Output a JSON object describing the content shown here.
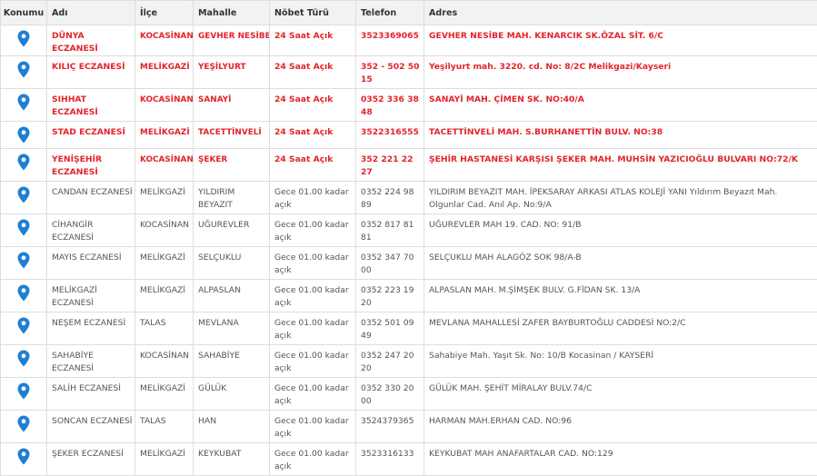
{
  "colors": {
    "duty": "#e3242b",
    "normal": "#555555",
    "pin": "#1f7fd2",
    "grid": "#dddddd",
    "header_bg": "#f2f2f2"
  },
  "header": {
    "konumu": "Konumu",
    "adi": "Adı",
    "ilce": "İlçe",
    "mahalle": "Mahalle",
    "nobet": "Nöbet Türü",
    "telefon": "Telefon",
    "adres": "Adres"
  },
  "rows": [
    {
      "duty": true,
      "name": "DÜNYA ECZANESİ",
      "ilce": "KOCASİNAN",
      "mahalle": "GEVHER NESİBE",
      "nobet": "24 Saat Açık",
      "telefon": "3523369065",
      "adres": "GEVHER NESİBE MAH. KENARCIK SK.ÖZAL SİT. 6/C",
      "icon": "map-pin-icon"
    },
    {
      "duty": true,
      "name": "KILIÇ ECZANESİ",
      "ilce": "MELİKGAZİ",
      "mahalle": "YEŞİLYURT",
      "nobet": "24 Saat Açık",
      "telefon": "352 - 502 50 15",
      "adres": "Yeşilyurt mah. 3220. cd. No: 8/2C Melikgazi/Kayseri",
      "icon": "map-pin-icon"
    },
    {
      "duty": true,
      "name": "SIHHAT ECZANESİ",
      "ilce": "KOCASİNAN",
      "mahalle": "SANAYİ",
      "nobet": "24 Saat Açık",
      "telefon": "0352 336 38 48",
      "adres": "SANAYİ MAH. ÇİMEN SK. NO:40/A",
      "icon": "map-pin-icon"
    },
    {
      "duty": true,
      "name": "STAD ECZANESİ",
      "ilce": "MELİKGAZİ",
      "mahalle": "TACETTİNVELİ",
      "nobet": "24 Saat Açık",
      "telefon": "3522316555",
      "adres": "TACETTİNVELİ MAH. S.BURHANETTİN BULV. NO:38",
      "icon": "map-pin-icon"
    },
    {
      "duty": true,
      "name": "YENİŞEHİR ECZANESİ",
      "ilce": "KOCASİNAN",
      "mahalle": "ŞEKER",
      "nobet": "24 Saat Açık",
      "telefon": "352 221 22 27",
      "adres": "ŞEHİR HASTANESİ KARŞISI ŞEKER MAH. MUHSİN YAZICIOĞLU BULVARI NO:72/K",
      "icon": "map-pin-icon"
    },
    {
      "duty": false,
      "name": "CANDAN ECZANESİ",
      "ilce": "MELİKGAZİ",
      "mahalle": "YILDIRIM BEYAZIT",
      "nobet": "Gece 01.00 kadar açık",
      "telefon": "0352 224 98 89",
      "adres": "YILDIRIM BEYAZIT MAH. İPEKSARAY ARKASI ATLAS KOLEJİ YANI Yıldırım Beyazıt Mah. Olgunlar Cad. Anıl Ap. No:9/A",
      "icon": "map-pin-icon"
    },
    {
      "duty": false,
      "name": "CİHANGİR ECZANESİ",
      "ilce": "KOCASİNAN",
      "mahalle": "UĞUREVLER",
      "nobet": "Gece 01.00 kadar açık",
      "telefon": "0352 817 81 81",
      "adres": "UĞUREVLER MAH 19. CAD. NO: 91/B",
      "icon": "map-pin-icon"
    },
    {
      "duty": false,
      "name": "MAYIS ECZANESİ",
      "ilce": "MELİKGAZİ",
      "mahalle": "SELÇUKLU",
      "nobet": "Gece 01.00 kadar açık",
      "telefon": "0352 347 70 00",
      "adres": "SELÇUKLU MAH ALAGÖZ SOK 98/A-B",
      "icon": "map-pin-icon"
    },
    {
      "duty": false,
      "name": "MELİKGAZİ ECZANESİ",
      "ilce": "MELİKGAZİ",
      "mahalle": "ALPASLAN",
      "nobet": "Gece 01.00 kadar açık",
      "telefon": "0352 223 19 20",
      "adres": "ALPASLAN MAH. M.ŞİMŞEK BULV. G.FİDAN SK. 13/A",
      "icon": "map-pin-icon"
    },
    {
      "duty": false,
      "name": "NEŞEM ECZANESİ",
      "ilce": "TALAS",
      "mahalle": "MEVLANA",
      "nobet": "Gece 01.00 kadar açık",
      "telefon": "0352 501 09 49",
      "adres": "MEVLANA MAHALLESİ ZAFER BAYBURTOĞLU CADDESİ NO:2/C",
      "icon": "map-pin-icon"
    },
    {
      "duty": false,
      "name": "SAHABİYE ECZANESİ",
      "ilce": "KOCASİNAN",
      "mahalle": "SAHABİYE",
      "nobet": "Gece 01.00 kadar açık",
      "telefon": "0352 247 20 20",
      "adres": "Sahabiye Mah. Yaşıt Sk. No: 10/B Kocasinan / KAYSERİ",
      "icon": "map-pin-icon"
    },
    {
      "duty": false,
      "name": "SALİH ECZANESİ",
      "ilce": "MELİKGAZİ",
      "mahalle": "GÜLÜK",
      "nobet": "Gece 01.00 kadar açık",
      "telefon": "0352 330 20 00",
      "adres": "GÜLÜK MAH. ŞEHİT MİRALAY BULV.74/C",
      "icon": "map-pin-icon"
    },
    {
      "duty": false,
      "name": "SONCAN ECZANESİ",
      "ilce": "TALAS",
      "mahalle": "HAN",
      "nobet": "Gece 01.00 kadar açık",
      "telefon": "3524379365",
      "adres": "HARMAN MAH.ERHAN CAD. NO:96",
      "icon": "map-pin-icon"
    },
    {
      "duty": false,
      "name": "ŞEKER ECZANESİ",
      "ilce": "MELİKGAZİ",
      "mahalle": "KEYKUBAT",
      "nobet": "Gece 01.00 kadar açık",
      "telefon": "3523316133",
      "adres": "KEYKUBAT MAH ANAFARTALAR CAD. NO:129",
      "icon": "map-pin-icon"
    }
  ]
}
